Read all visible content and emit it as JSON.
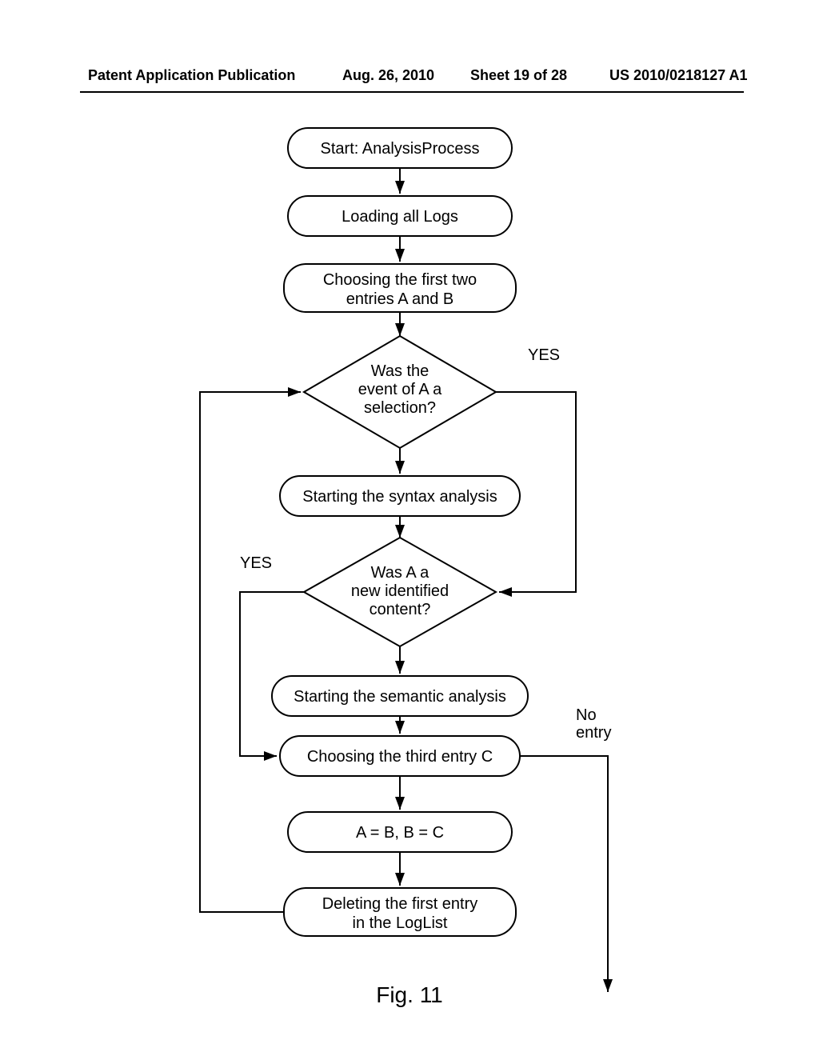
{
  "header": {
    "pub_type": "Patent Application Publication",
    "date": "Aug. 26, 2010",
    "sheet": "Sheet 19 of 28",
    "docnum": "US 2010/0218127 A1"
  },
  "nodes": {
    "start": "Start: AnalysisProcess",
    "load": "Loading all Logs",
    "choose_ab_l1": "Choosing the first two",
    "choose_ab_l2": "entries A and B",
    "dec1_l1": "Was the",
    "dec1_l2": "event of A a",
    "dec1_l3": "selection?",
    "syntax": "Starting the syntax analysis",
    "dec2_l1": "Was A a",
    "dec2_l2": "new identified",
    "dec2_l3": "content?",
    "semantic": "Starting the semantic analysis",
    "choose_c": "Choosing the third entry C",
    "assign": "A = B, B = C",
    "delete_l1": "Deleting the first entry",
    "delete_l2": "in the LogList"
  },
  "edges": {
    "yes1": "YES",
    "yes2": "YES",
    "noentry_l1": "No",
    "noentry_l2": "entry"
  },
  "figure_caption": "Fig. 11"
}
